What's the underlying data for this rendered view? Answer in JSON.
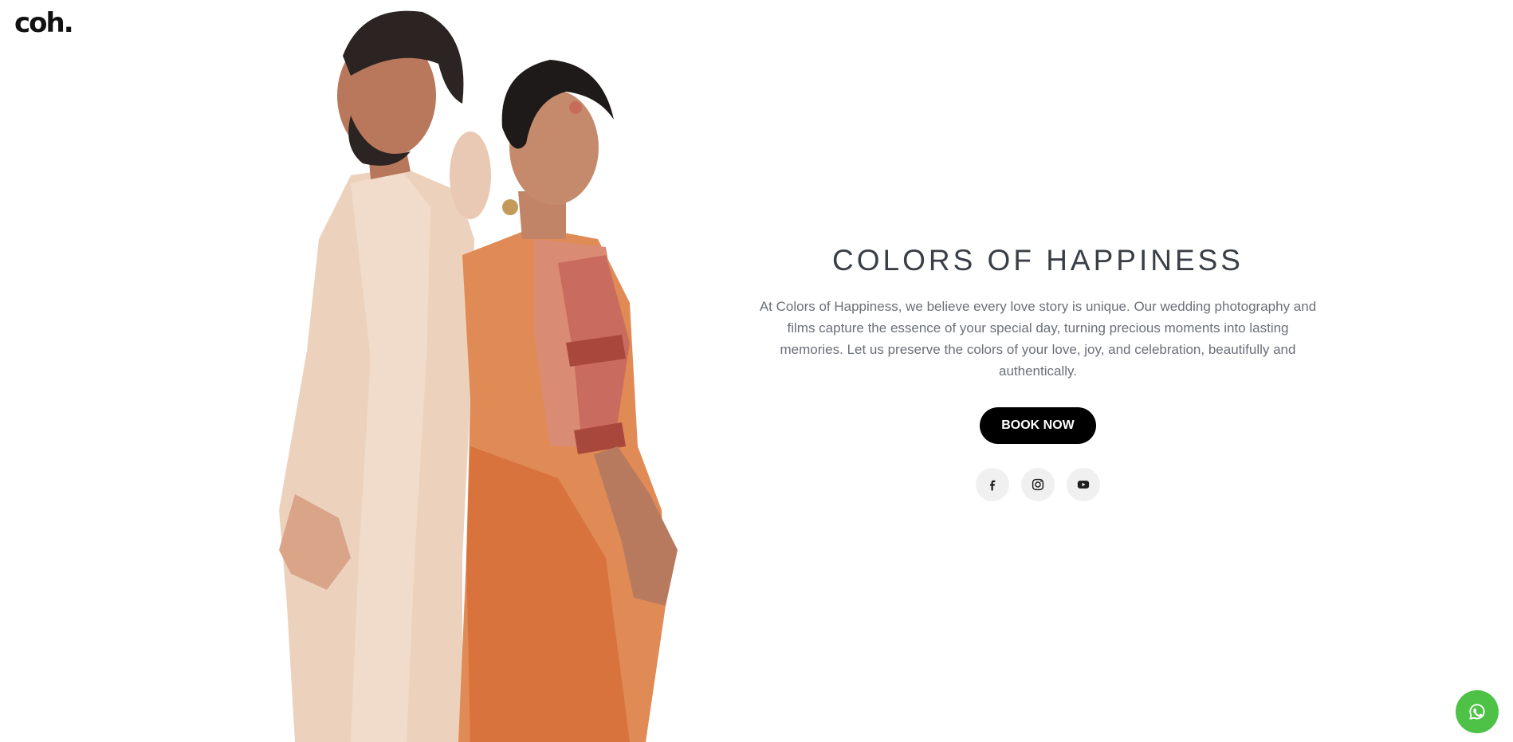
{
  "header": {
    "logo_text": "coh."
  },
  "hero": {
    "title": "COLORS OF HAPPINESS",
    "description": "At Colors of Happiness, we believe every love story is unique. Our wedding photography and films capture the essence of your special day, turning precious moments into lasting memories. Let us preserve the colors of your love, joy, and celebration, beautifully and authentically.",
    "book_button_label": "BOOK NOW",
    "photo_icon": "couple-photo"
  },
  "social": [
    {
      "icon": "facebook-icon"
    },
    {
      "icon": "instagram-icon"
    },
    {
      "icon": "youtube-icon"
    }
  ],
  "floating": {
    "icon": "whatsapp-icon",
    "color": "#4dc247"
  },
  "colors": {
    "title": "#3a3f47",
    "text": "#6b6f78",
    "button_bg": "#000000",
    "social_bg": "#f0f0f1"
  }
}
